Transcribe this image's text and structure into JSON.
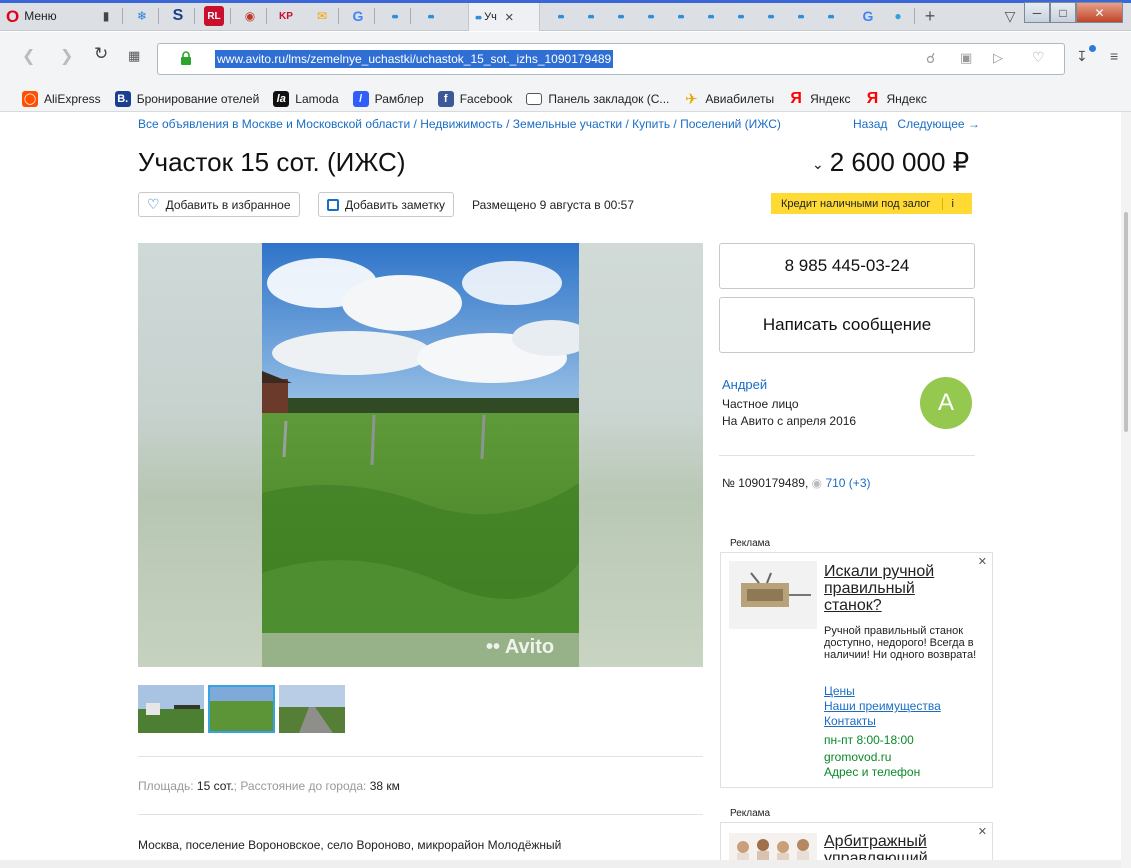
{
  "browser": {
    "menu_label": "Меню",
    "active_tab_label": "Уч",
    "url": "www.avito.ru/lms/zemelnye_uchastki/uchastok_15_sot._izhs_1090179489",
    "bookmarks": [
      {
        "label": "AliExpress",
        "icon": "aliexpress-icon",
        "color": "#ff4f00"
      },
      {
        "label": "Бронирование отелей",
        "icon": "booking-icon",
        "color": "#1a3f8f"
      },
      {
        "label": "Lamoda",
        "icon": "lamoda-icon",
        "color": "#111111"
      },
      {
        "label": "Рамблер",
        "icon": "rambler-icon",
        "color": "#315efb"
      },
      {
        "label": "Facebook",
        "icon": "facebook-icon",
        "color": "#3b5998"
      },
      {
        "label": "Панель закладок (С...",
        "icon": "folder-icon",
        "color": "#ffffff"
      },
      {
        "label": "Авиабилеты",
        "icon": "plane-icon",
        "color": "#ffcc00"
      },
      {
        "label": "Яндекс",
        "icon": "yandex-icon",
        "color": "#ff0000"
      },
      {
        "label": "Яндекс",
        "icon": "yandex-icon",
        "color": "#ff0000"
      }
    ]
  },
  "listing": {
    "breadcrumb": "Все объявления в Москве и Московской области / Недвижимость / Земельные участки / Купить / Поселений (ИЖС)",
    "back_label": "Назад",
    "next_label": "Следующее →",
    "title": "Участок 15 сот. (ИЖС)",
    "price": "2 600 000 ₽",
    "favorite_label": "Добавить в избранное",
    "note_label": "Добавить заметку",
    "posted": "Размещено 9 августа в 00:57",
    "credit_label": "Кредит наличными под залог",
    "credit_info": "i",
    "watermark": "Avito",
    "params_area_label": "Площадь:",
    "params_area_value": "15 сот.",
    "params_distance_label": "Расстояние до города:",
    "params_distance_value": "38 км",
    "address": "Москва, поселение Вороновское, село Вороново, микрорайон Молодёжный"
  },
  "contact": {
    "phone": "8 985 445-03-24",
    "message_label": "Написать сообщение",
    "seller_name": "Андрей",
    "seller_type": "Частное лицо",
    "seller_since": "На Авито с апреля 2016",
    "avatar_letter": "А",
    "item_number": "№ 1090179489,",
    "views": "710 (+3)"
  },
  "ads": [
    {
      "label": "Реклама",
      "title": "Искали ручной правильный станок?",
      "text": "Ручной правильный станок доступно, недорого! Всегда в наличии! Ни одного возврата!",
      "links": [
        "Цены",
        "Наши преимущества",
        "Контакты"
      ],
      "hours": "пн-пт 8:00-18:00",
      "domain": "gromovod.ru",
      "extra": "Адрес и телефон"
    },
    {
      "label": "Реклама",
      "title": "Арбитражный управляющий"
    }
  ],
  "colors": {
    "link": "#1a6dc4",
    "credit_bg": "#ffd934",
    "avatar_bg": "#94c84f",
    "ad_green": "#0a8a28"
  }
}
